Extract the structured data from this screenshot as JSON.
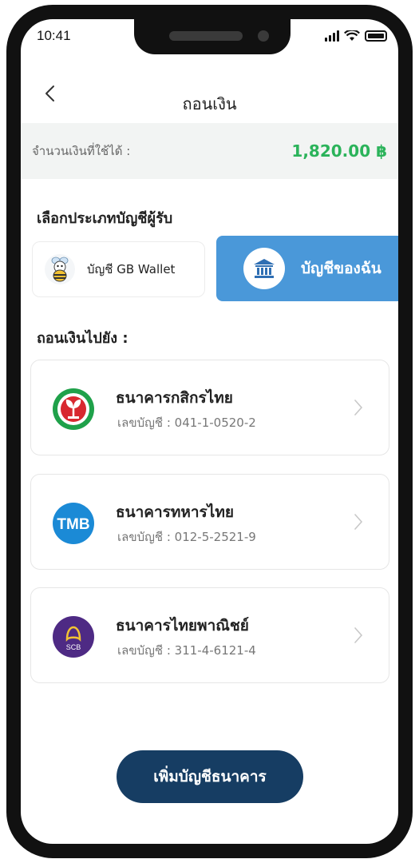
{
  "status_bar": {
    "time": "10:41"
  },
  "header": {
    "title": "ถอนเงิน",
    "back_icon": "chevron-left-icon"
  },
  "balance": {
    "label": "จำนวนเงินที่ใช้ได้ :",
    "value": "1,820.00 ฿",
    "color": "#2bb35a"
  },
  "account_type": {
    "section_title": "เลือกประเภทบัญชีผู้รับ",
    "options": [
      {
        "label": "บัญชี GB Wallet",
        "icon": "bee-mascot-icon",
        "selected": false
      },
      {
        "label": "บัญชีของฉัน",
        "icon": "bank-building-icon",
        "selected": true
      }
    ],
    "selected_color": "#4a98d9"
  },
  "withdraw_to": {
    "section_title": "ถอนเงินไปยัง :",
    "banks": [
      {
        "name": "ธนาคารกสิกรไทย",
        "account": "เลขบัญชี : 041-1-0520-2",
        "logo": "kbank-logo-icon"
      },
      {
        "name": "ธนาคารทหารไทย",
        "account": "เลขบัญชี : 012-5-2521-9",
        "logo": "tmb-logo-icon",
        "logo_text": "TMB"
      },
      {
        "name": "ธนาคารไทยพาณิชย์",
        "account": "เลขบัญชี : 311-4-6121-4",
        "logo": "scb-logo-icon",
        "logo_text": "SCB"
      }
    ]
  },
  "add_bank_button": {
    "label": "เพิ่มบัญชีธนาคาร",
    "color": "#163d63"
  }
}
